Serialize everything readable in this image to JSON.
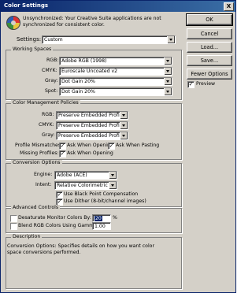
{
  "window": {
    "title": "Color Settings",
    "close_glyph": "X"
  },
  "message": "Unsynchronized: Your Creative Suite applications are not synchronized for consistent color.",
  "buttons": {
    "ok": "OK",
    "cancel": "Cancel",
    "load": "Load...",
    "save": "Save...",
    "fewer_options": "Fewer Options"
  },
  "preview": {
    "label": "Preview",
    "checked": true
  },
  "settings": {
    "label": "Settings:",
    "value": "Custom"
  },
  "working_spaces": {
    "title": "Working Spaces",
    "rows": [
      {
        "label": "RGB:",
        "value": "Adobe RGB (1998)"
      },
      {
        "label": "CMYK:",
        "value": "Euroscale Uncoated v2"
      },
      {
        "label": "Gray:",
        "value": "Dot Gain 20%"
      },
      {
        "label": "Spot:",
        "value": "Dot Gain 20%"
      }
    ]
  },
  "policies": {
    "title": "Color Management Policies",
    "rows": [
      {
        "label": "RGB:",
        "value": "Preserve Embedded Profiles"
      },
      {
        "label": "CMYK:",
        "value": "Preserve Embedded Profiles"
      },
      {
        "label": "Gray:",
        "value": "Preserve Embedded Profiles"
      }
    ],
    "mismatch_label": "Profile Mismatches:",
    "ask_opening": "Ask When Opening",
    "ask_pasting": "Ask When Pasting",
    "missing_label": "Missing Profiles:",
    "missing_ask_opening": "Ask When Opening"
  },
  "conversion": {
    "title": "Conversion Options",
    "engine_label": "Engine:",
    "engine_value": "Adobe (ACE)",
    "intent_label": "Intent:",
    "intent_value": "Relative Colorimetric",
    "bpc": "Use Black Point Compensation",
    "dither": "Use Dither (8-bit/channel images)"
  },
  "advanced": {
    "title": "Advanced Controls",
    "desaturate_label": "Desaturate Monitor Colors By:",
    "desaturate_value": "20",
    "percent": "%",
    "blend_label": "Blend RGB Colors Using Gamma:",
    "blend_value": "1.00"
  },
  "description": {
    "title": "Description",
    "text": "Conversion Options: Specifies details on how you want color space conversions performed."
  },
  "check_glyph": "✓"
}
